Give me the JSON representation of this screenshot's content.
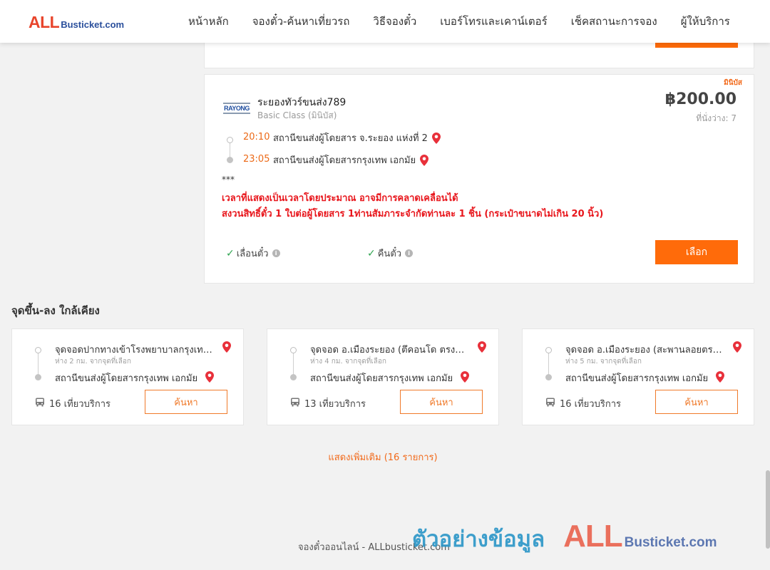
{
  "header": {
    "logo_all": "ALL",
    "logo_rest": "Busticket.com",
    "nav": [
      "หน้าหลัก",
      "จองตั๋ว-ค้นหาเที่ยวรถ",
      "วิธีจองตั๋ว",
      "เบอร์โทรและเคาน์เตอร์",
      "เช็คสถานะการจอง",
      "ผู้ให้บริการ"
    ]
  },
  "trip": {
    "tag": "มินิบัส",
    "operator_logo": "RAYONG",
    "operator": "ระยองทัวร์ขนส่ง789",
    "bus_class": "Basic Class (มินิบัส)",
    "price": "฿200.00",
    "seats": "ที่นั่งว่าง: 7",
    "depart_time": "20:10",
    "depart_station": "สถานีขนส่งผู้โดยสาร จ.ระยอง แห่งที่ 2",
    "arrive_time": "23:05",
    "arrive_station": "สถานีขนส่งผู้โดยสารกรุงเทพ เอกมัย",
    "stars": "***",
    "notice_1": "เวลาที่แสดงเป็นเวลาโดยประมาณ อาจมีการคลาดเคลื่อนได้",
    "notice_2": "สงวนสิทธิ์ตั๋ว 1 ใบต่อผู้โดยสาร 1ท่านสัมภาระจำกัดท่านละ 1 ชิ้น (กระเป๋าขนาดไม่เกิน 20 นิ้ว)",
    "policy_reschedule": "เลื่อนตั๋ว",
    "policy_refund": "คืนตั๋ว",
    "select_label": "เลือก"
  },
  "nearby": {
    "title": "จุดขึ้น-ลง ใกล้เคียง",
    "cards": [
      {
        "from": "จุดจอดปากทางเข้าโรงพยาบาลกรุงเทพ ระยอง",
        "distance": "ห่าง 2 กม. จากจุดที่เลือก",
        "to": "สถานีขนส่งผู้โดยสารกรุงเทพ เอกมัย",
        "trips": "16 เที่ยวบริการ",
        "search_label": "ค้นหา"
      },
      {
        "from": "จุดจอด อ.เมืองระยอง (ตึคอนโด ตรงข้ามห้าง)",
        "distance": "ห่าง 4 กม. จากจุดที่เลือก",
        "to": "สถานีขนส่งผู้โดยสารกรุงเทพ เอกมัย",
        "trips": "13 เที่ยวบริการ",
        "search_label": "ค้นหา"
      },
      {
        "from": "จุดจอด อ.เมืองระยอง (สะพานลอยตรงข้าม)",
        "distance": "ห่าง 5 กม. จากจุดที่เลือก",
        "to": "สถานีขนส่งผู้โดยสารกรุงเทพ เอกมัย",
        "trips": "16 เที่ยวบริการ",
        "search_label": "ค้นหา"
      }
    ],
    "show_more": "แสดงเพิ่มเติม (16 รายการ)"
  },
  "footer": {
    "text": "จองตั๋วออนไลน์ - ALLbusticket.com"
  },
  "watermark": {
    "thai": "ตัวอย่างข้อมูล",
    "all": "ALL",
    "rest": "Busticket.com"
  },
  "colors": {
    "accent": "#ff6b0a",
    "notice": "#e8161c",
    "time": "#ec6a18",
    "pin": "#e8303a"
  },
  "icons": [
    "location-pin-icon",
    "check-icon",
    "info-icon",
    "bus-icon"
  ]
}
